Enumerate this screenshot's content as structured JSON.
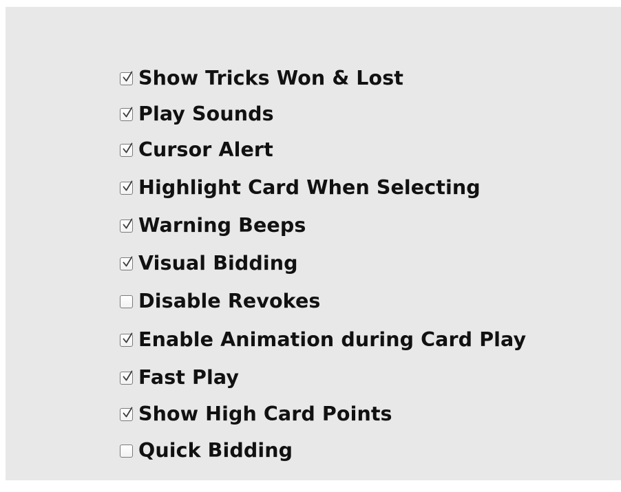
{
  "options": [
    {
      "label": "Show Tricks Won & Lost",
      "checked": true
    },
    {
      "label": "Play Sounds",
      "checked": true
    },
    {
      "label": "Cursor Alert",
      "checked": true
    },
    {
      "label": "Highlight Card When Selecting",
      "checked": true
    },
    {
      "label": "Warning Beeps",
      "checked": true
    },
    {
      "label": "Visual Bidding",
      "checked": true
    },
    {
      "label": "Disable Revokes",
      "checked": false
    },
    {
      "label": "Enable Animation during Card Play",
      "checked": true
    },
    {
      "label": "Fast Play",
      "checked": true
    },
    {
      "label": "Show High Card Points",
      "checked": true
    },
    {
      "label": "Quick Bidding",
      "checked": false
    }
  ]
}
